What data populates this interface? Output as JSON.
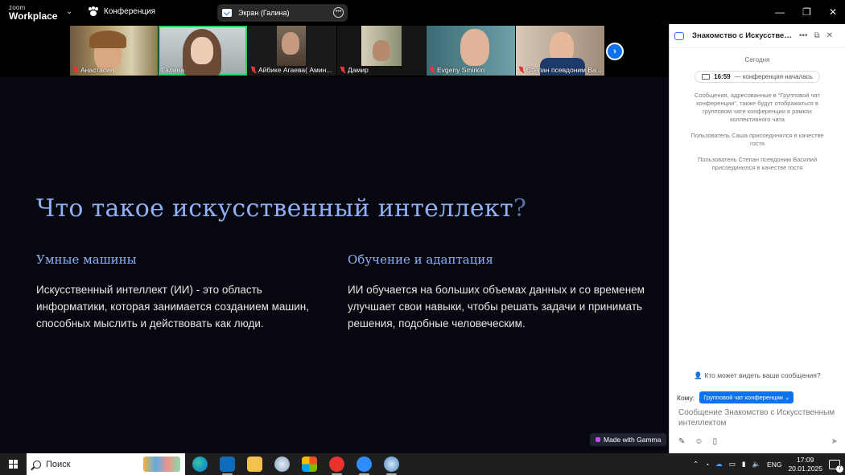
{
  "app": {
    "logo_small": "zoom",
    "logo_big": "Workplace",
    "meeting_label": "Конференция",
    "share_label": "Экран (Галина)"
  },
  "window_controls": {
    "minimize": "—",
    "restore": "❐",
    "close": "✕"
  },
  "participants": [
    {
      "name": "Анастасия",
      "muted": true
    },
    {
      "name": "Галина",
      "muted": false,
      "active": true
    },
    {
      "name": "Айбике Агаева( Амин...",
      "muted": true
    },
    {
      "name": "Дамир",
      "muted": true
    },
    {
      "name": "Evgeny Smirkin",
      "muted": true
    },
    {
      "name": "Степан псевдоним Ва...",
      "muted": true
    }
  ],
  "slide": {
    "title": "Что такое искусственный интеллект",
    "title_mark": "?",
    "col1_heading": "Умные машины",
    "col1_text": "Искусственный интеллект (ИИ) - это область информатики, которая занимается созданием машин, способных мыслить и действовать как люди.",
    "col2_heading": "Обучение и адаптация",
    "col2_text": "ИИ обучается на больших объемах данных и со временем улучшает свои навыки, чтобы решать задачи и принимать решения, подобные человеческим.",
    "badge": "Made with Gamma"
  },
  "chat": {
    "title": "Знакомство с Искусственным интеллектом",
    "date": "Сегодня",
    "start_time": "16:59",
    "start_text": "— конференция началась",
    "messages": [
      "Сообщения, адресованные в \"Групповой чат конференции\", также будут отображаться в групповом чате конференции в рамках коллективного чата",
      "Пользователь Саша присоединился в качестве гостя",
      "Пользователь Степан псевдоним Василий присоединился в качестве гостя"
    ],
    "who_can_see": "Кто может видеть ваши сообщения?",
    "to_label": "Кому:",
    "to_value": "Групповой чат конференции",
    "input_placeholder": "Сообщение Знакомство с Искусственным интеллектом"
  },
  "taskbar": {
    "search_label": "Поиск",
    "lang": "ENG",
    "time": "17:09",
    "date": "20.01.2025",
    "notifications": "7"
  }
}
